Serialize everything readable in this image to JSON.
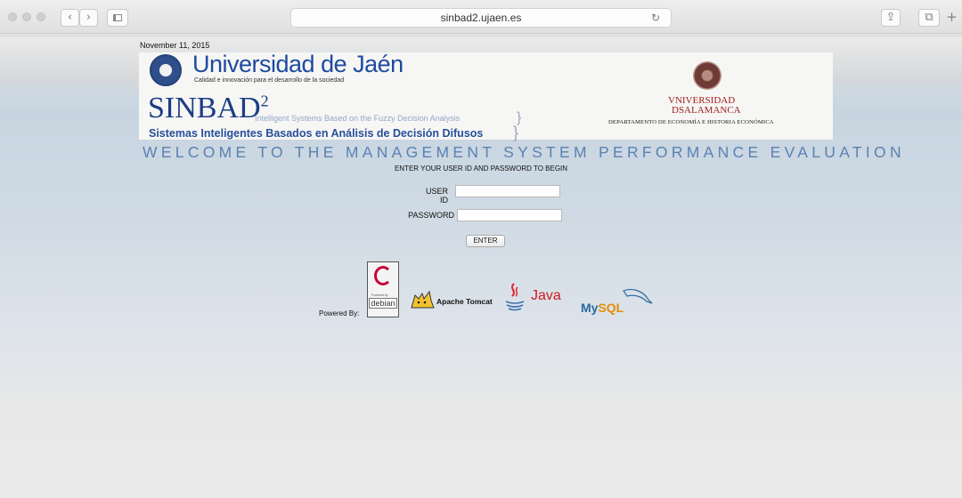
{
  "browser": {
    "url": "sinbad2.ujaen.es",
    "back_label": "‹",
    "forward_label": "›",
    "reload_glyph": "↻",
    "share_glyph": "⇪",
    "tabs_glyph": "⧉",
    "newtab_glyph": "+"
  },
  "header": {
    "date": "November 11, 2015",
    "uja_name": "Universidad de Jaén",
    "uja_tagline": "Calidad e innovación para el desarrollo de la sociedad",
    "sinbad_title": "SINBAD",
    "sinbad_sup": "2",
    "sinbad_en": "Intelligent Systems Based on the Fuzzy Decision Analysis",
    "sinbad_es": "Sistemas Inteligentes Basados en Análisis de Decisión Difusos",
    "usal_line1": "VNIVERSIDAD",
    "usal_line2": "DSALAMANCA",
    "usal_dept": "DEPARTAMENTO DE ECONOMÍA E HISTORIA ECONÓMICA"
  },
  "main": {
    "welcome": "WELCOME TO THE MANAGEMENT SYSTEM PERFORMANCE EVALUATION",
    "instructions": "ENTER YOUR USER ID AND PASSWORD TO BEGIN",
    "user_id_label": "USER ID",
    "user_id_value": "",
    "password_label": "PASSWORD",
    "password_value": "",
    "enter_label": "ENTER"
  },
  "footer": {
    "powered_by": "Powered By:",
    "debian_small": "Powered by",
    "debian_name": "debian",
    "tomcat": "Apache Tomcat",
    "java": "Java",
    "mysql_my": "My",
    "mysql_sql": "SQL"
  }
}
